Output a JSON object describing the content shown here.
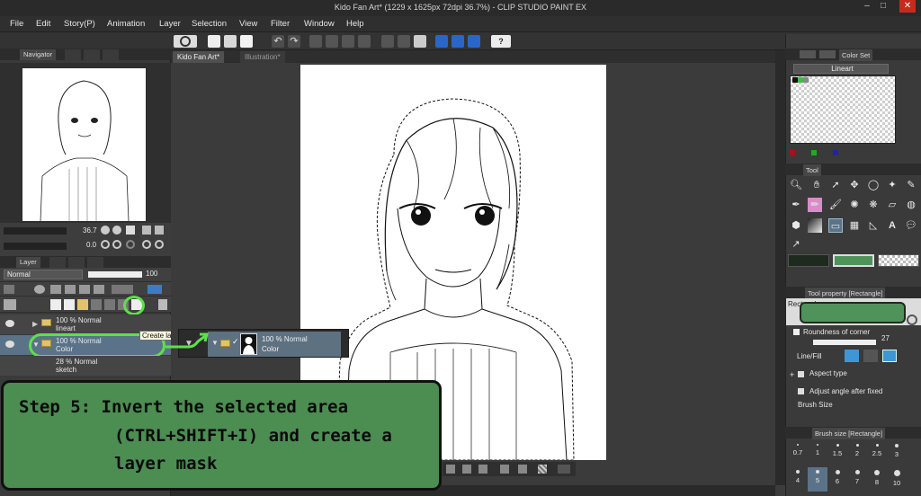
{
  "window": {
    "title": "Kido Fan Art* (1229 x 1625px 72dpi 36.7%) - CLIP STUDIO PAINT EX"
  },
  "menu": [
    "File",
    "Edit",
    "Story(P)",
    "Animation",
    "Layer",
    "Selection",
    "View",
    "Filter",
    "Window",
    "Help"
  ],
  "navigator": {
    "tab_label": "Navigator",
    "zoom": "36.7",
    "rotation": "0.0"
  },
  "layer_panel": {
    "tab_label": "Layer",
    "blend_mode": "Normal",
    "opacity": "100",
    "tooltip": "Create lay",
    "layers": [
      {
        "line1": "100 % Normal",
        "line2": "lineart"
      },
      {
        "line1": "100 % Normal",
        "line2": "Color"
      },
      {
        "line1": "28 % Normal",
        "line2": "sketch"
      }
    ]
  },
  "popup": {
    "line1": "100 % Normal",
    "line2": "Color"
  },
  "documents": {
    "tabs": [
      "Kido Fan Art*",
      "Illustration*"
    ]
  },
  "right_panel": {
    "color_set": {
      "tab_label": "Color Set",
      "set_name": "Lineart"
    },
    "tool": {
      "tab_label": "Tool"
    },
    "tool_property": {
      "tab_label": "Tool property [Rectangle]",
      "tool_name": "Rectangle",
      "roundness_label": "Roundness of corner",
      "roundness_value": "27",
      "linefill_label": "Line/Fill",
      "aspect_label": "Aspect type",
      "adjust_label": "Adjust angle after fixed",
      "brushsize_label": "Brush Size"
    },
    "brush_size": {
      "tab_label": "Brush size [Rectangle]",
      "sizes": [
        "0.7",
        "1",
        "1.5",
        "2",
        "2.5",
        "3",
        "4",
        "5",
        "6",
        "7",
        "8",
        "10"
      ]
    }
  },
  "annotation": {
    "line1": "Step 5: Invert the selected area",
    "line2": "(CTRL+SHIFT+I) and create a",
    "line3": "layer mask"
  },
  "colors": {
    "highlight_green": "#5ee04a",
    "step_box_green": "#4c8d52",
    "popup_blue": "#5e7181",
    "selected_layer_blue": "#5b7388"
  }
}
